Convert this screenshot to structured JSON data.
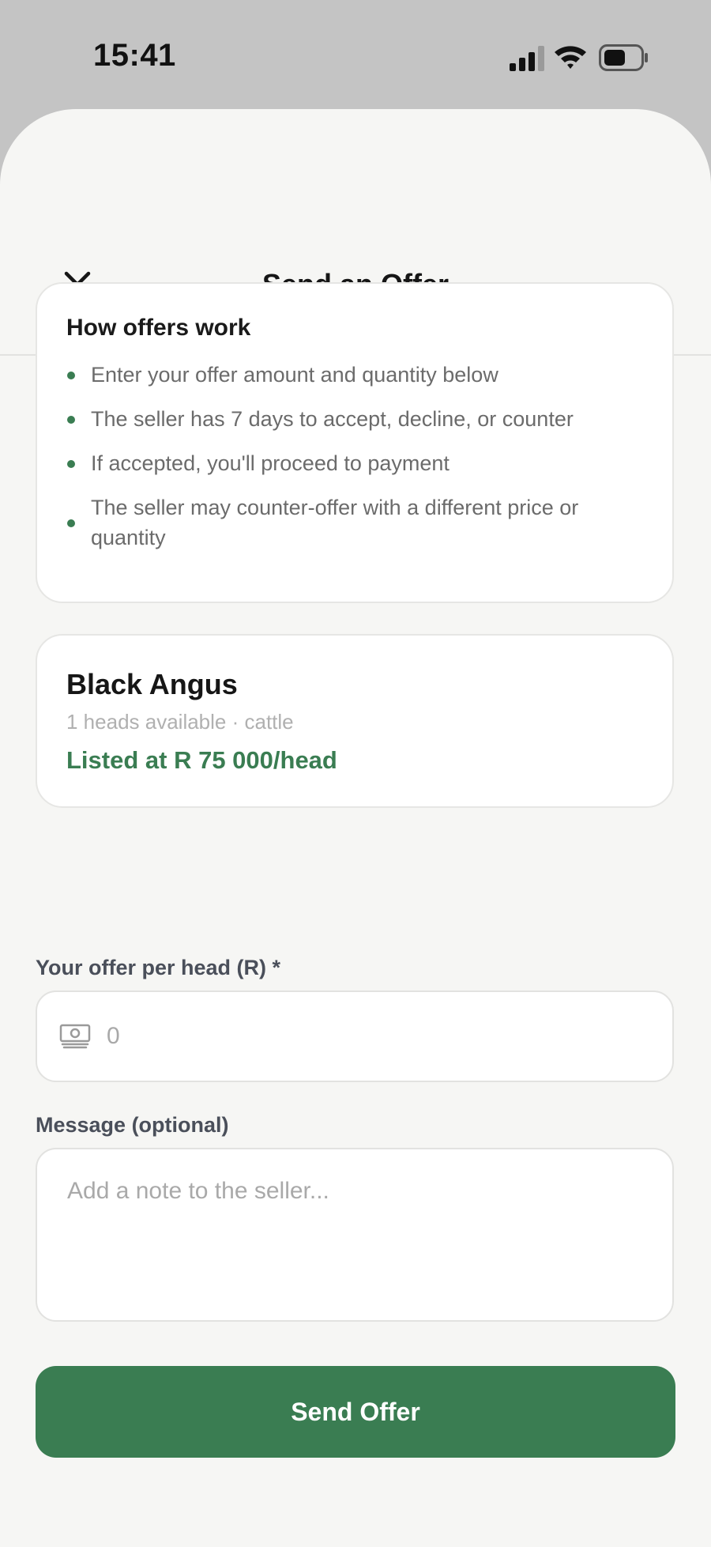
{
  "status_bar": {
    "time": "15:41",
    "icons": [
      "signal-icon",
      "wifi-icon",
      "battery-icon"
    ]
  },
  "header": {
    "title": "Send an Offer",
    "close_icon": "close-icon"
  },
  "info": {
    "title": "How offers work",
    "bullets": [
      "Enter your offer amount and quantity below",
      "The seller has 7 days to accept, decline, or counter",
      "If accepted, you'll proceed to payment",
      "The seller may counter-offer with a different price or quantity"
    ]
  },
  "listing": {
    "title": "Black Angus",
    "subtitle": "1 heads available · cattle",
    "price": "Listed at R 75 000/head"
  },
  "form": {
    "offer_label": "Your offer per head (R) *",
    "offer_placeholder": "0",
    "offer_icon": "cash-icon",
    "message_label": "Message (optional)",
    "message_placeholder": "Add a note to the seller..."
  },
  "actions": {
    "send_label": "Send Offer"
  },
  "colors": {
    "accent": "#3a7d52",
    "sheet_bg": "#f6f6f4",
    "backdrop": "#c4c4c4"
  }
}
